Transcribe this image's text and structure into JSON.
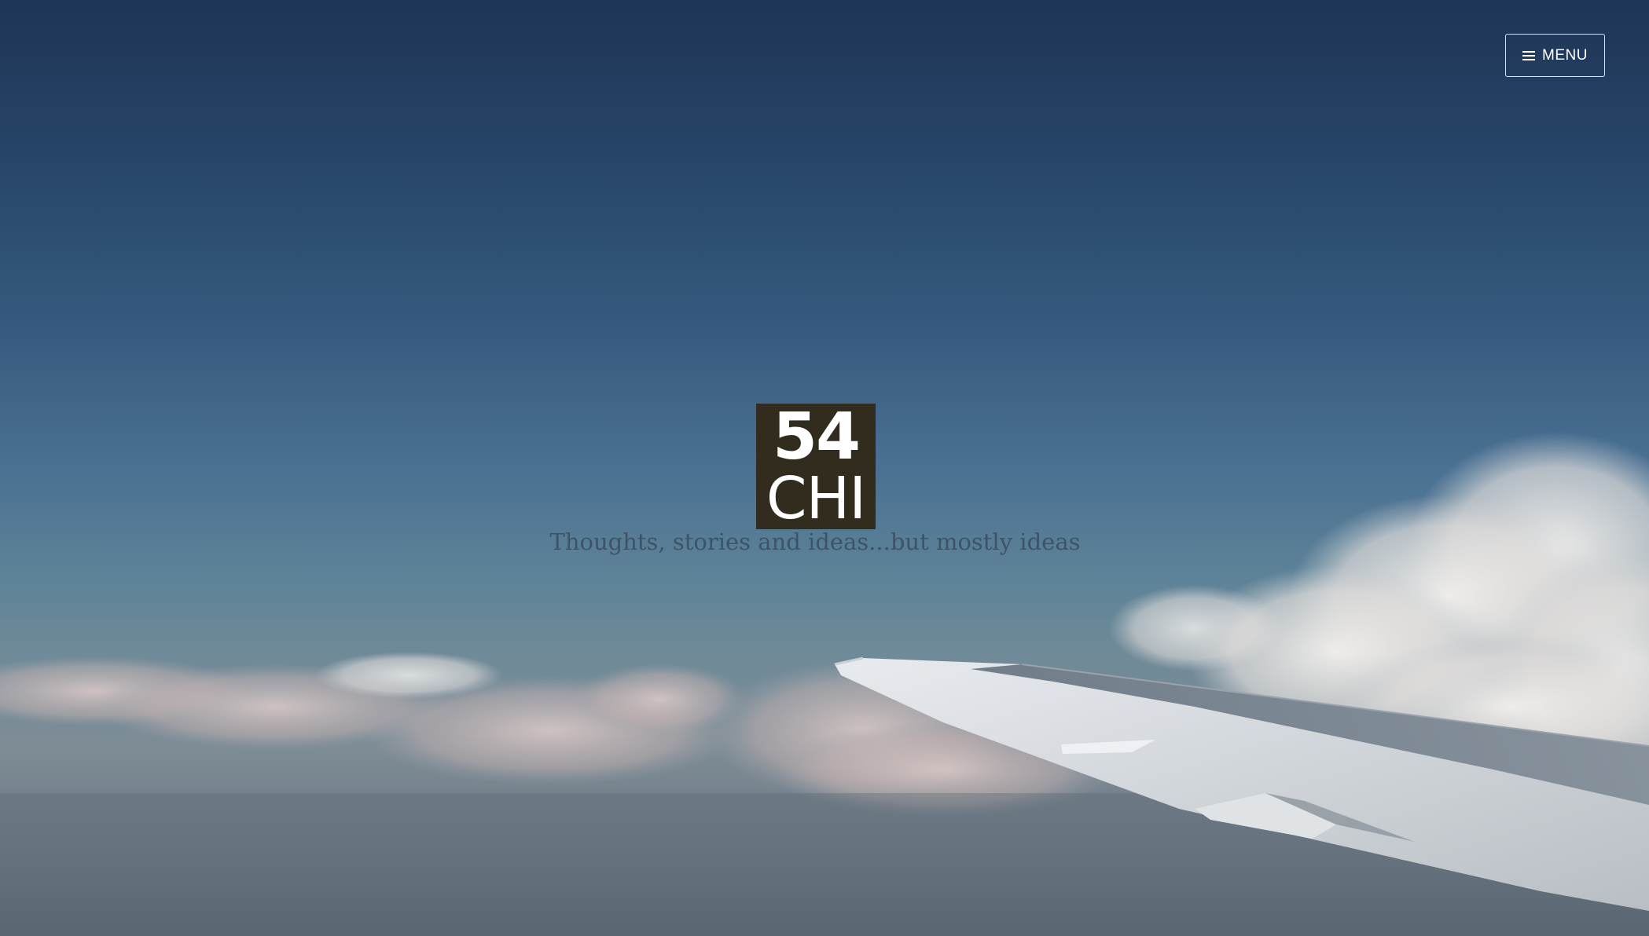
{
  "header": {
    "menu_label": "MENU",
    "menu_icon": "hamburger-menu-icon"
  },
  "branding": {
    "logo_line1": "54",
    "logo_line2": "CHI",
    "tagline": "Thoughts, stories and ideas...but mostly ideas"
  },
  "background": {
    "description_icon": "sky-with-airplane-wing",
    "colors": {
      "sky_top": "#1e3556",
      "sky_mid": "#4a7092",
      "horizon": "#7e8c96",
      "logo_bg": "#312c1d",
      "tagline": "#3f5366"
    }
  }
}
